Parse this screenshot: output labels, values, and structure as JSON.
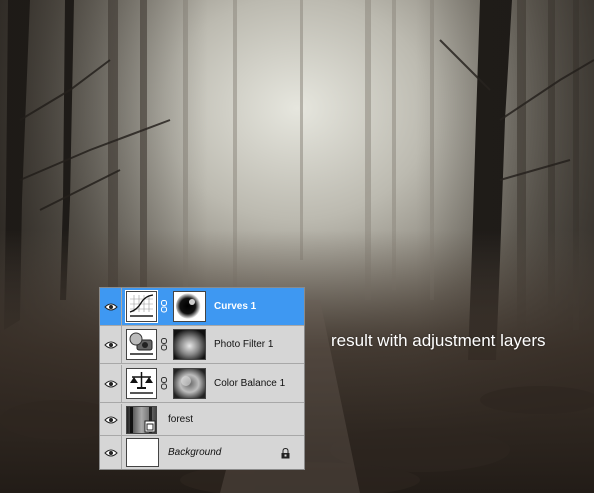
{
  "caption": "result with adjustment layers",
  "layers_panel": {
    "layers": [
      {
        "name": "Curves 1",
        "type": "curves",
        "selected": true,
        "visible": true,
        "icon": "curves-adjustment-icon",
        "has_mask": true
      },
      {
        "name": "Photo Filter 1",
        "type": "photo-filter",
        "selected": false,
        "visible": true,
        "icon": "photo-filter-adjustment-icon",
        "has_mask": true
      },
      {
        "name": "Color Balance 1",
        "type": "color-balance",
        "selected": false,
        "visible": true,
        "icon": "color-balance-adjustment-icon",
        "has_mask": true
      },
      {
        "name": "forest",
        "type": "smart-object",
        "selected": false,
        "visible": true,
        "icon": "smart-object-thumbnail"
      },
      {
        "name": "Background",
        "type": "background",
        "selected": false,
        "visible": true,
        "locked": true,
        "icon": "lock-icon"
      }
    ]
  },
  "colors": {
    "selected_layer": "#3e98f2",
    "panel_bg": "#d6d6d6",
    "caption_text": "#ffffff"
  }
}
